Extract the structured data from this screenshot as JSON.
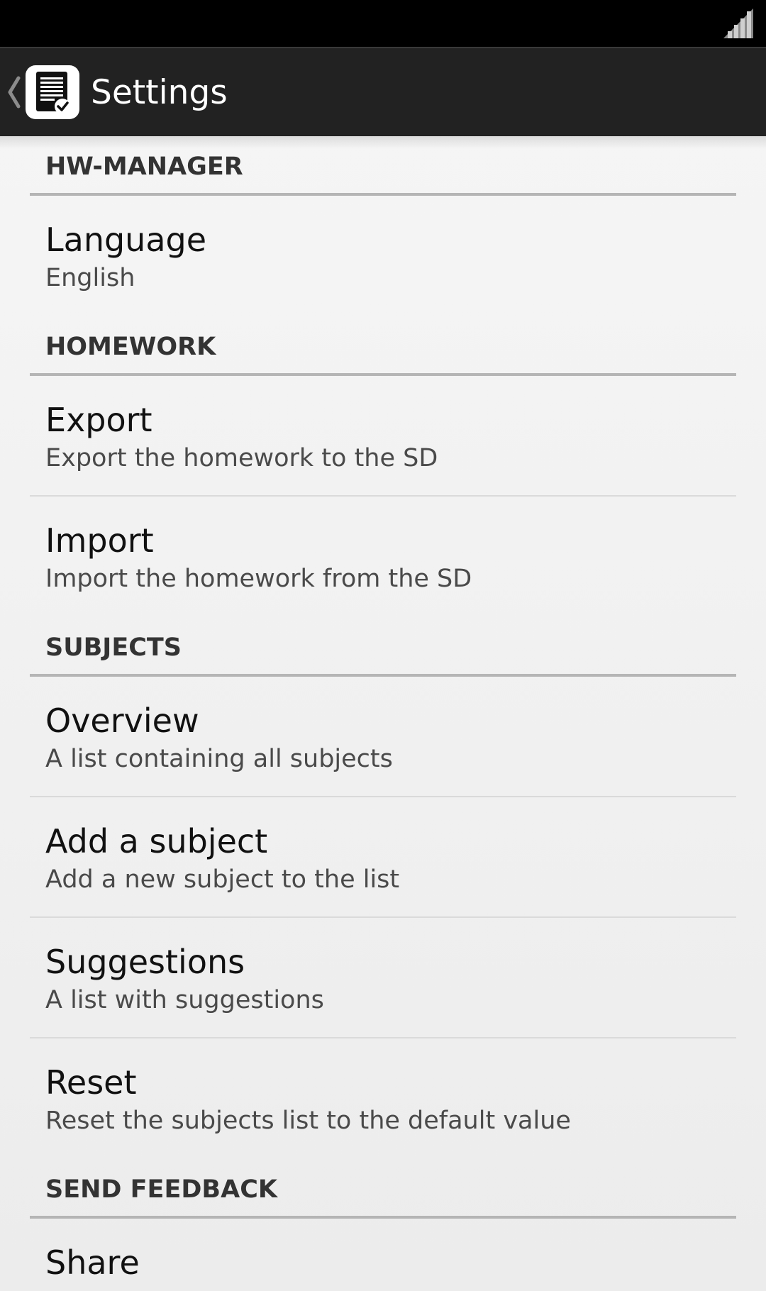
{
  "status_bar": {
    "signal_icon": "signal-full-icon"
  },
  "action_bar": {
    "up_icon": "chevron-left-icon",
    "app_icon": "homework-document-icon",
    "title": "Settings"
  },
  "sections": [
    {
      "title": "HW-MANAGER",
      "items": [
        {
          "title": "Language",
          "summary": "English"
        }
      ]
    },
    {
      "title": "HOMEWORK",
      "items": [
        {
          "title": "Export",
          "summary": "Export the homework to the SD"
        },
        {
          "title": "Import",
          "summary": "Import the homework from the SD"
        }
      ]
    },
    {
      "title": "SUBJECTS",
      "items": [
        {
          "title": "Overview",
          "summary": "A list containing all subjects"
        },
        {
          "title": "Add a subject",
          "summary": "Add a new subject to the list"
        },
        {
          "title": "Suggestions",
          "summary": "A list with suggestions"
        },
        {
          "title": "Reset",
          "summary": "Reset the subjects list to the default value"
        }
      ]
    },
    {
      "title": "SEND FEEDBACK",
      "items": [
        {
          "title": "Share",
          "summary": ""
        }
      ]
    }
  ],
  "colors": {
    "status_bar": "#000000",
    "action_bar": "#222222",
    "category_text": "#333333",
    "category_divider": "#b5b5b5",
    "item_divider": "#dadada"
  }
}
